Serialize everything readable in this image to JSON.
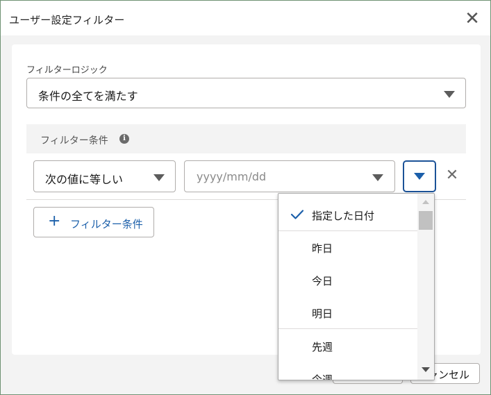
{
  "dialog": {
    "title": "ユーザー設定フィルター",
    "close_icon": "close-icon"
  },
  "logic": {
    "label": "フィルターロジック",
    "value": "条件の全てを満たす"
  },
  "conditions": {
    "header": "フィルター条件",
    "info_icon": "info-icon",
    "operator": "次の値に等しい",
    "date_placeholder": "yyyy/mm/dd",
    "remove_icon": "close-icon",
    "add_label": "フィルター条件"
  },
  "footer": {
    "ok_label": "",
    "cancel_label": "ャンセル"
  },
  "date_menu": {
    "items": [
      {
        "label": "指定した日付",
        "selected": true
      },
      {
        "label": "昨日",
        "selected": false
      },
      {
        "label": "今日",
        "selected": false
      },
      {
        "label": "明日",
        "selected": false
      },
      {
        "label": "先週",
        "selected": false
      },
      {
        "label": "今週",
        "selected": false
      }
    ]
  },
  "colors": {
    "accent": "#1b5faa",
    "focus_border": "#1b5297",
    "frame_border": "#6e9173"
  }
}
